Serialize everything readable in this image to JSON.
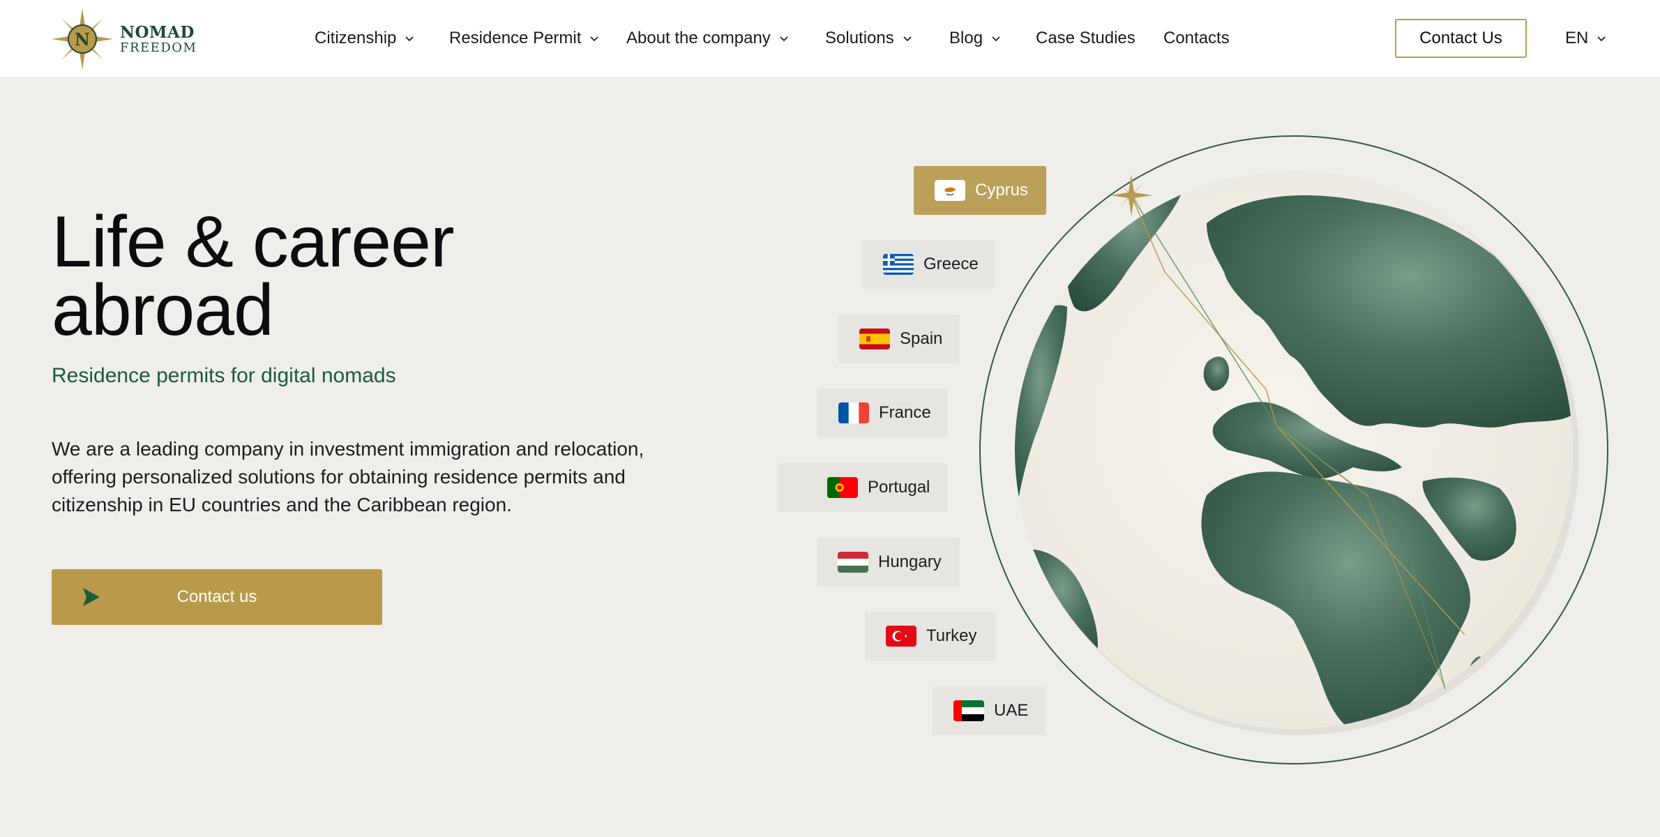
{
  "brand": {
    "line1": "NOMAD",
    "line2": "FREEDOM",
    "emblem_letter": "N"
  },
  "nav": {
    "items": [
      {
        "label": "Citizenship",
        "has_dropdown": true
      },
      {
        "label": "Residence Permit",
        "has_dropdown": true
      },
      {
        "label": "About the company",
        "has_dropdown": true
      },
      {
        "label": "Solutions",
        "has_dropdown": true
      },
      {
        "label": "Blog",
        "has_dropdown": true
      },
      {
        "label": "Case Studies",
        "has_dropdown": false
      },
      {
        "label": "Contacts",
        "has_dropdown": false
      }
    ],
    "contact_button": "Contact Us",
    "language": "EN"
  },
  "hero": {
    "title_line1": "Life & career",
    "title_line2": "abroad",
    "subtitle": "Residence permits for digital nomads",
    "description": "We are a leading company in investment immigration and relocation, offering personalized solutions for obtaining residence permits and citizenship in EU countries and the Caribbean region.",
    "cta_label": "Contact us"
  },
  "countries": {
    "selected": "Cyprus",
    "items": [
      {
        "name": "Cyprus",
        "flag": "cyprus-flag-icon"
      },
      {
        "name": "Greece",
        "flag": "greece-flag-icon"
      },
      {
        "name": "Spain",
        "flag": "spain-flag-icon"
      },
      {
        "name": "France",
        "flag": "france-flag-icon"
      },
      {
        "name": "Portugal",
        "flag": "portugal-flag-icon"
      },
      {
        "name": "Hungary",
        "flag": "hungary-flag-icon"
      },
      {
        "name": "Turkey",
        "flag": "turkey-flag-icon"
      },
      {
        "name": "UAE",
        "flag": "uae-flag-icon"
      }
    ]
  },
  "colors": {
    "accent_gold": "#b89a4a",
    "brand_green": "#1a5c3a",
    "globe_green": "#3f6a55",
    "background": "#efeeeb"
  }
}
